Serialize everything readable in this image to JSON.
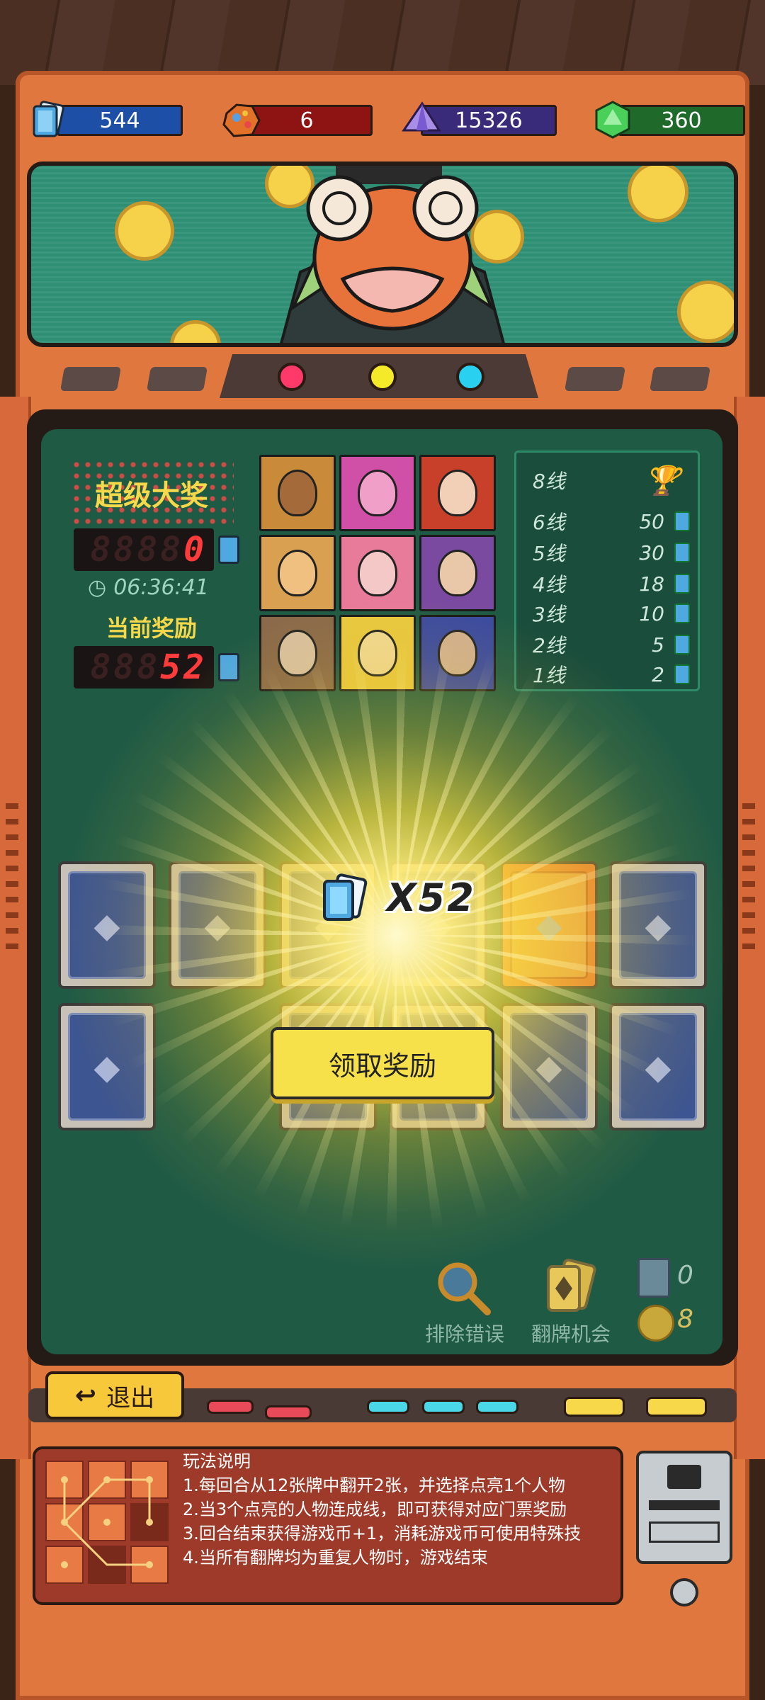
{
  "resources": [
    {
      "icon": "ticket-icon",
      "value": "544",
      "color": "#1d4fa6"
    },
    {
      "icon": "ore-icon",
      "value": "6",
      "color": "#8e1414"
    },
    {
      "icon": "purple-crystal-icon",
      "value": "15326",
      "color": "#3a2a7a"
    },
    {
      "icon": "green-gem-icon",
      "value": "360",
      "color": "#1f6a2a"
    }
  ],
  "jackpot": {
    "title": "超级大奖",
    "value": "0",
    "timer": "06:36:41",
    "current_label": "当前奖励",
    "current_value": "52"
  },
  "lines": [
    {
      "label": "8线",
      "reward": "",
      "icon": "trophy-icon"
    },
    {
      "label": "6线",
      "reward": "50"
    },
    {
      "label": "5线",
      "reward": "30"
    },
    {
      "label": "4线",
      "reward": "18"
    },
    {
      "label": "3线",
      "reward": "10"
    },
    {
      "label": "2线",
      "reward": "5"
    },
    {
      "label": "1线",
      "reward": "2"
    }
  ],
  "reward_popup": {
    "amount": "X52",
    "button": "领取奖励"
  },
  "tools": [
    {
      "label": "排除错误",
      "icon": "magnifier-icon"
    },
    {
      "label": "翻牌机会",
      "icon": "flip-cards-icon"
    }
  ],
  "counters": [
    {
      "icon": "card-counter-icon",
      "value": "0"
    },
    {
      "icon": "coin-counter-icon",
      "value": "8"
    }
  ],
  "exit_button": "退出",
  "rules": {
    "title": "玩法说明",
    "lines": [
      "1.每回合从12张牌中翻开2张，并选择点亮1个人物",
      "2.当3个点亮的人物连成线，即可获得对应门票奖励",
      "3.回合结束获得游戏币+1，消耗游戏币可使用特殊技",
      "4.当所有翻牌均为重复人物时，游戏结束"
    ]
  },
  "colors": {
    "board": "#1f5a45",
    "cabinet": "#e0773e",
    "accent_yellow": "#f7e14a",
    "led_red": "#ff3b3b"
  }
}
